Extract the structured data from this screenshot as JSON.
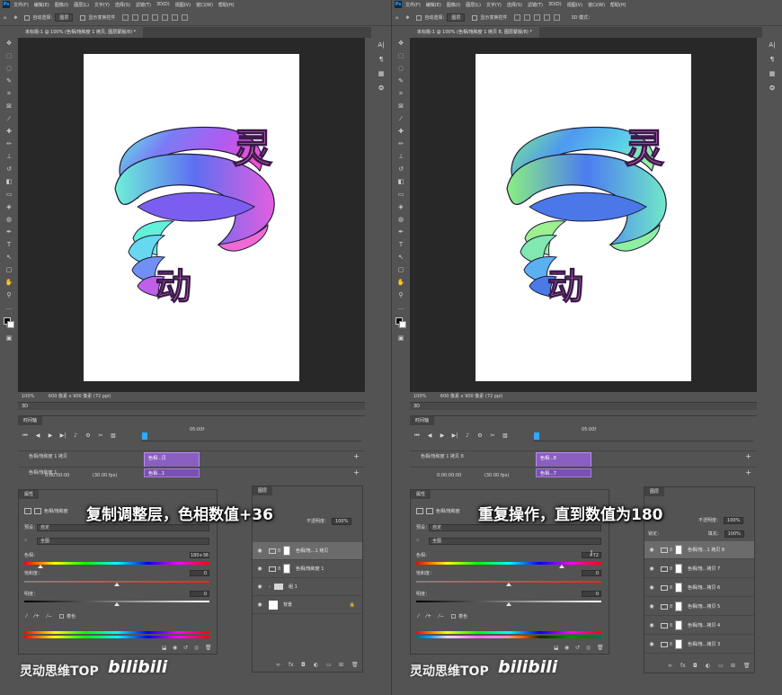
{
  "menu": {
    "app_icon": "Ps",
    "items": [
      "文件(F)",
      "编辑(E)",
      "图像(I)",
      "图层(L)",
      "文字(Y)",
      "选择(S)",
      "滤镜(T)",
      "3D(D)",
      "视图(V)",
      "窗口(W)",
      "帮助(H)"
    ]
  },
  "options_bar": {
    "auto_select_label": "自动选择：",
    "auto_select_value": "图层",
    "transform_label": "显示变换控件",
    "mode_3d_label": "3D 模式："
  },
  "panes": {
    "left": {
      "tab_title": "未标题-1 @ 100% (色相/饱和度 1 拷贝, 图层蒙版/8) *",
      "status_zoom": "100%",
      "status_size": "600 像素 x 900 像素 (72 ppi)",
      "timeline_track_1": "色相/饱和度 1 拷贝",
      "timeline_track_2": "色相/饱和度 1",
      "clip_1_label": "色相...贝",
      "clip_2_label": "色相...1",
      "layers": [
        {
          "name": "色相/饱...1 拷贝",
          "type": "adjustment",
          "selected": true
        },
        {
          "name": "色相/饱和度 1",
          "type": "adjustment",
          "selected": false
        },
        {
          "name": "组 1",
          "type": "group",
          "selected": false
        },
        {
          "name": "背景",
          "type": "background",
          "selected": false
        }
      ],
      "caption": "复制调整层，色相数值+36"
    },
    "right": {
      "tab_title": "未标题-1 @ 100% (色相/饱和度 1 拷贝 8, 图层蒙版/8) *",
      "status_zoom": "100%",
      "status_size": "600 像素 x 900 像素 (72 ppi)",
      "timeline_track_1": "色相/饱和度 1 拷贝 8",
      "timeline_track_2": "",
      "clip_1_label": "色相...8",
      "clip_2_label": "色相...7",
      "layers": [
        {
          "name": "色相/饱...1 拷贝 8",
          "type": "adjustment",
          "selected": true
        },
        {
          "name": "色相/饱...拷贝 7",
          "type": "adjustment",
          "selected": false
        },
        {
          "name": "色相/饱...拷贝 6",
          "type": "adjustment",
          "selected": false
        },
        {
          "name": "色相/饱...拷贝 5",
          "type": "adjustment",
          "selected": false
        },
        {
          "name": "色相/饱...拷贝 4",
          "type": "adjustment",
          "selected": false
        },
        {
          "name": "色相/饱...拷贝 3",
          "type": "adjustment",
          "selected": false
        }
      ],
      "caption": "重复操作，直到数值为180"
    }
  },
  "panel_3d_label": "3D",
  "timeline": {
    "title": "时间轴",
    "time_end": "05:00f",
    "current_time": "0:00:00:00",
    "fps": "(30.00 fps)"
  },
  "properties": {
    "title": "属性",
    "adjustment_name": "色相/饱和度",
    "preset_label": "预设：",
    "preset_value": "自定",
    "channel_value": "全图",
    "hue_label": "色相：",
    "hue_value_left": "180+36",
    "hue_value_right": "+72",
    "saturation_label": "饱和度：",
    "saturation_value": "0",
    "lightness_label": "明度：",
    "lightness_value": "0",
    "colorize_label": "着色"
  },
  "layers_panel": {
    "title": "图层",
    "opacity_label": "不透明度：",
    "opacity_value": "100%",
    "lock_label": "锁定：",
    "fill_label": "填充：",
    "fill_value": "100%"
  },
  "artwork": {
    "char_top": "灵",
    "char_bottom": "动"
  },
  "watermark": {
    "text": "灵动思维TOP",
    "logo": "bilibili"
  }
}
